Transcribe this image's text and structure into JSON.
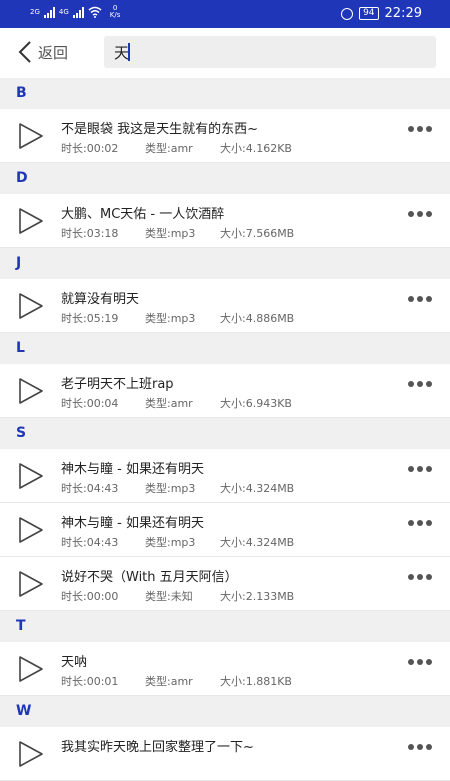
{
  "status_bar": {
    "signal1": "2G",
    "signal2": "4G",
    "net_speed_value": "0",
    "net_speed_unit": "K/s",
    "battery": "94",
    "time": "22:29"
  },
  "header": {
    "back_label": "返回",
    "search_value": "天"
  },
  "sections": [
    {
      "letter": "B",
      "items": [
        {
          "title": "不是眼袋 我这是天生就有的东西~",
          "duration": "时长:00:02",
          "type": "类型:amr",
          "size": "大小:4.162KB"
        }
      ]
    },
    {
      "letter": "D",
      "items": [
        {
          "title": "大鹏、MC天佑 - 一人饮酒醉",
          "duration": "时长:03:18",
          "type": "类型:mp3",
          "size": "大小:7.566MB"
        }
      ]
    },
    {
      "letter": "J",
      "items": [
        {
          "title": "就算没有明天",
          "duration": "时长:05:19",
          "type": "类型:mp3",
          "size": "大小:4.886MB"
        }
      ]
    },
    {
      "letter": "L",
      "items": [
        {
          "title": "老子明天不上班rap",
          "duration": "时长:00:04",
          "type": "类型:amr",
          "size": "大小:6.943KB"
        }
      ]
    },
    {
      "letter": "S",
      "items": [
        {
          "title": "神木与瞳 - 如果还有明天",
          "duration": "时长:04:43",
          "type": "类型:mp3",
          "size": "大小:4.324MB"
        },
        {
          "title": "神木与瞳 - 如果还有明天",
          "duration": "时长:04:43",
          "type": "类型:mp3",
          "size": "大小:4.324MB"
        },
        {
          "title": "说好不哭（With 五月天阿信）",
          "duration": "时长:00:00",
          "type": "类型:未知",
          "size": "大小:2.133MB"
        }
      ]
    },
    {
      "letter": "T",
      "items": [
        {
          "title": "天呐",
          "duration": "时长:00:01",
          "type": "类型:amr",
          "size": "大小:1.881KB"
        }
      ]
    },
    {
      "letter": "W",
      "items": [
        {
          "title": "我其实昨天晚上回家整理了一下~",
          "duration": "",
          "type": "",
          "size": ""
        }
      ]
    }
  ]
}
